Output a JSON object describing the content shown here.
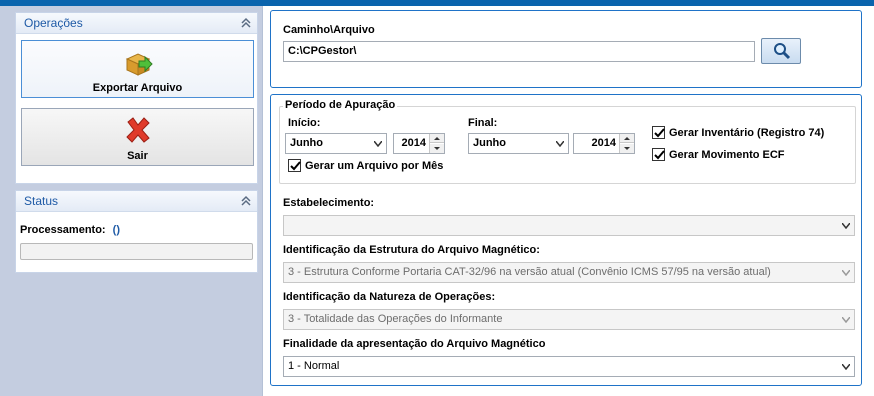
{
  "left": {
    "operacoes_panel": {
      "title": "Operações",
      "export_button": "Exportar Arquivo",
      "exit_button": "Sair"
    },
    "status_panel": {
      "title": "Status",
      "processamento_label": "Processamento:",
      "processamento_value": "()"
    }
  },
  "main": {
    "path_label": "Caminho\\Arquivo",
    "path_value": "C:\\CPGestor\\",
    "periodo": {
      "legend": "Período de Apuração",
      "inicio_label": "Início:",
      "inicio_month": "Junho",
      "inicio_year": "2014",
      "final_label": "Final:",
      "final_month": "Junho",
      "final_year": "2014",
      "gerar_arquivo_mes": "Gerar um Arquivo por Mês",
      "gerar_inventario": "Gerar Inventário (Registro 74)",
      "gerar_movimento": "Gerar Movimento ECF"
    },
    "estabelecimento_label": "Estabelecimento:",
    "estabelecimento_value": "",
    "estrutura_label": "Identificação da Estrutura do Arquivo Magnético:",
    "estrutura_value": "3 - Estrutura Conforme Portaria CAT-32/96 na versão atual (Convênio ICMS 57/95 na versão atual)",
    "natureza_label": "Identificação da Natureza de Operações:",
    "natureza_value": "3 - Totalidade das Operações do Informante",
    "finalidade_label": "Finalidade da apresentação do Arquivo Magnético",
    "finalidade_value": "1 - Normal"
  },
  "colors": {
    "accent": "#1f73c8",
    "header_text": "#1e5aa6",
    "left_background": "#c4cde0",
    "top_bar": "#0a64ad"
  }
}
